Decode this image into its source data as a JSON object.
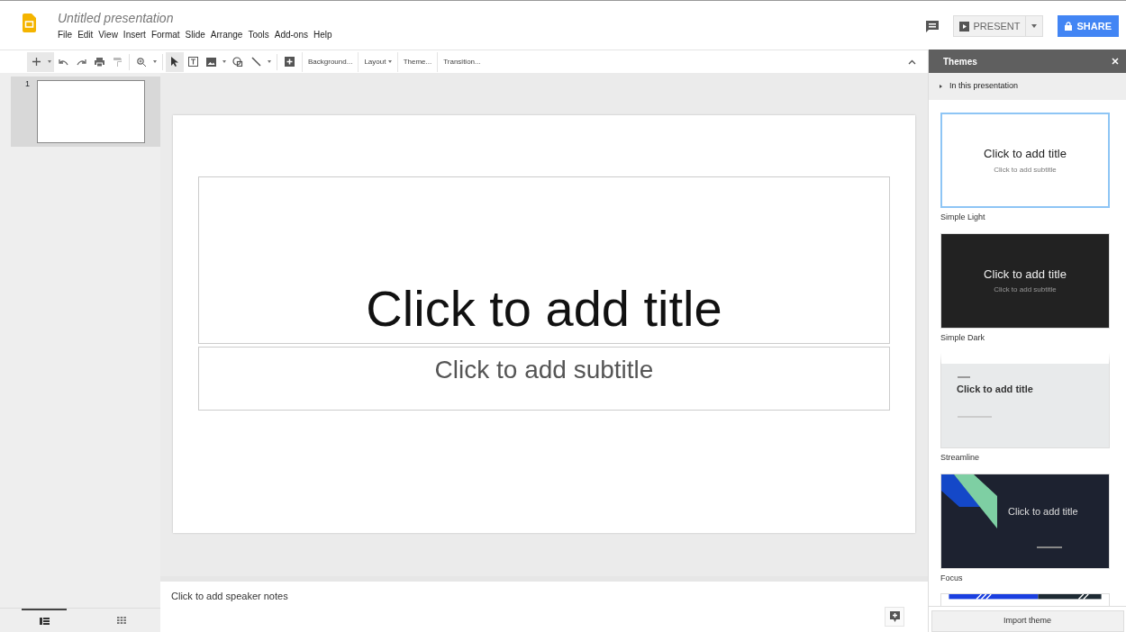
{
  "document": {
    "title": "Untitled presentation"
  },
  "menu": [
    "File",
    "Edit",
    "View",
    "Insert",
    "Format",
    "Slide",
    "Arrange",
    "Tools",
    "Add-ons",
    "Help"
  ],
  "header_buttons": {
    "present": "PRESENT",
    "share": "SHARE"
  },
  "toolbar_text_buttons": [
    {
      "label": "Background...",
      "dropdown": false
    },
    {
      "label": "Layout",
      "dropdown": true
    },
    {
      "label": "Theme...",
      "dropdown": false
    },
    {
      "label": "Transition...",
      "dropdown": false
    }
  ],
  "filmstrip": [
    {
      "number": "1",
      "selected": true
    }
  ],
  "view_toggles": [
    {
      "kind": "filmstrip",
      "selected": true
    },
    {
      "kind": "grid",
      "selected": false
    }
  ],
  "slide": {
    "title_placeholder": "Click to add title",
    "subtitle_placeholder": "Click to add subtitle"
  },
  "speaker_notes": {
    "placeholder": "Click to add speaker notes"
  },
  "themes_panel": {
    "title": "Themes",
    "section": "In this presentation",
    "themes": [
      {
        "kind": "light",
        "name": "Simple Light",
        "title": "Click to add title",
        "subtitle": "Click to add subtitle",
        "selected": true
      },
      {
        "kind": "dark",
        "name": "Simple Dark",
        "title": "Click to add title",
        "subtitle": "Click to add subtitle",
        "selected": false
      },
      {
        "kind": "streamline",
        "name": "Streamline",
        "title": "Click to add title",
        "selected": false
      },
      {
        "kind": "focus",
        "name": "Focus",
        "title": "Click to add title",
        "selected": false
      },
      {
        "kind": "partial",
        "selected": false
      }
    ],
    "import_button": "Import theme"
  }
}
